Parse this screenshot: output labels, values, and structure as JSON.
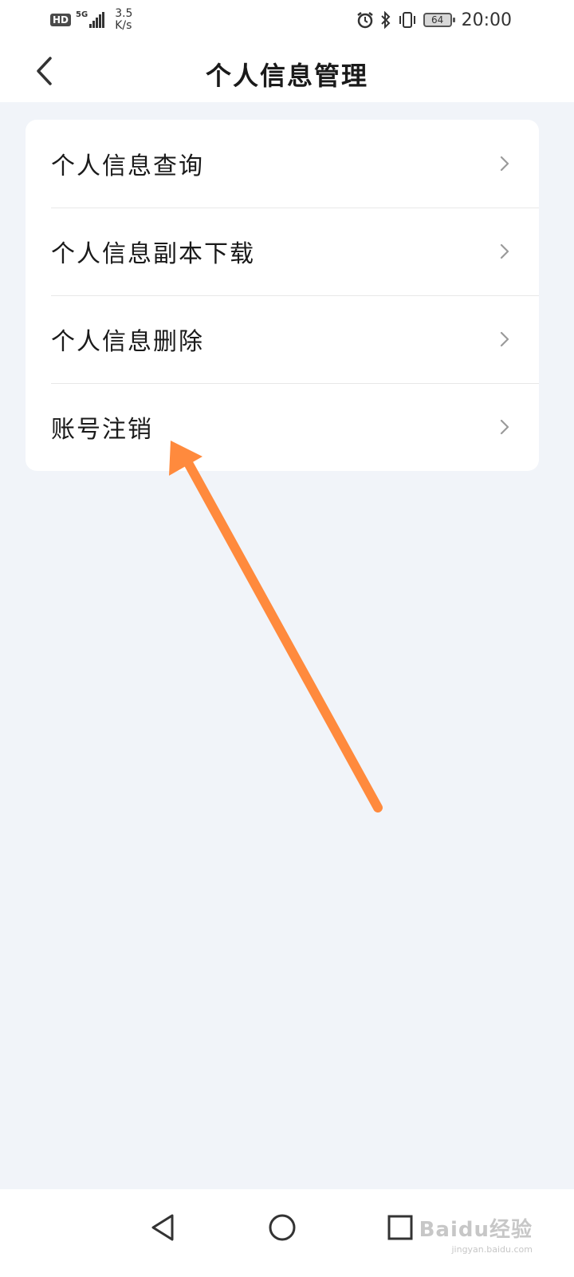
{
  "status_bar": {
    "hd": "HD",
    "network": "5G",
    "speed_value": "3.5",
    "speed_unit": "K/s",
    "battery": "64",
    "time": "20:00"
  },
  "header": {
    "title": "个人信息管理",
    "back_icon": "chevron-left-icon"
  },
  "menu": {
    "items": [
      {
        "label": "个人信息查询"
      },
      {
        "label": "个人信息副本下载"
      },
      {
        "label": "个人信息删除"
      },
      {
        "label": "账号注销"
      }
    ]
  },
  "annotation": {
    "color": "#ff8a3d"
  },
  "watermark": {
    "main": "Baidu经验",
    "sub": "jingyan.baidu.com"
  },
  "colors": {
    "background": "#f1f4f9",
    "card": "#ffffff",
    "text": "#1a1a1a",
    "chevron": "#9a9a9a"
  }
}
